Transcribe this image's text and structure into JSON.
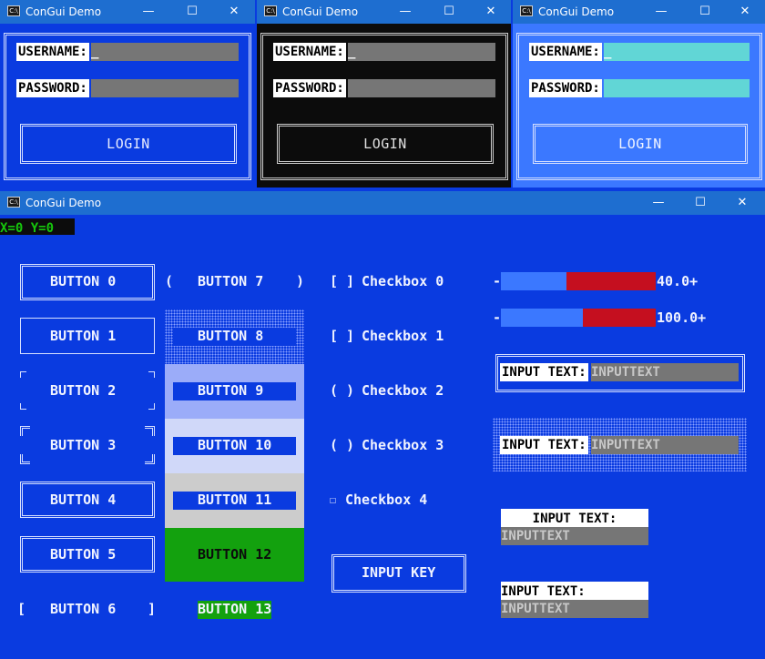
{
  "login_windows": [
    {
      "title": "ConGui Demo",
      "username_label": "USERNAME:",
      "cursor": "_",
      "password_label": "PASSWORD:",
      "login_label": "LOGIN",
      "theme": "blue"
    },
    {
      "title": "ConGui Demo",
      "username_label": "USERNAME:",
      "cursor": "_",
      "password_label": "PASSWORD:",
      "login_label": "LOGIN",
      "theme": "black"
    },
    {
      "title": "ConGui Demo",
      "username_label": "USERNAME:",
      "cursor": "_",
      "password_label": "PASSWORD:",
      "login_label": "LOGIN",
      "theme": "lightblue"
    }
  ],
  "main": {
    "title": "ConGui Demo",
    "coords": "X=0 Y=0",
    "buttons": [
      "BUTTON 0",
      "BUTTON 1",
      "BUTTON 2",
      "BUTTON 3",
      "BUTTON 4",
      "BUTTON 5",
      "BUTTON 6",
      "BUTTON 7",
      "BUTTON 8",
      "BUTTON 9",
      "BUTTON 10",
      "BUTTON 11",
      "BUTTON 12",
      "BUTTON 13"
    ],
    "bracket_open": "[",
    "bracket_close": "]",
    "paren_open": "(",
    "paren_close": ")",
    "checkboxes": [
      {
        "mark": "[ ]",
        "label": "Checkbox 0"
      },
      {
        "mark": "[ ]",
        "label": "Checkbox 1"
      },
      {
        "mark": "( )",
        "label": "Checkbox 2"
      },
      {
        "mark": "( )",
        "label": "Checkbox 3"
      },
      {
        "mark": "☐",
        "label": "Checkbox 4"
      }
    ],
    "input_key": "INPUT KEY",
    "progress": [
      {
        "prefix": "-",
        "value": "40.0+",
        "fill": 0.4
      },
      {
        "prefix": "-",
        "value": "100.0+",
        "fill": 0.5
      }
    ],
    "inputs": [
      {
        "label": "INPUT TEXT:",
        "value": "INPUTTEXT"
      },
      {
        "label": "INPUT TEXT:",
        "value": "INPUTTEXT"
      },
      {
        "label": "INPUT TEXT:",
        "value": "INPUTTEXT"
      },
      {
        "label": "INPUT TEXT:",
        "value": "INPUTTEXT"
      }
    ]
  },
  "colors": {
    "blue": "#0a3be0",
    "black": "#0c0c0c",
    "lightblue": "#3b78ff",
    "field_gray": "#767676",
    "field_cyan": "#61d6d6",
    "green": "#13a10e",
    "progress_fill": "#3b78ff",
    "progress_empty": "#c50f1f",
    "coords_fg": "#16c60c"
  }
}
